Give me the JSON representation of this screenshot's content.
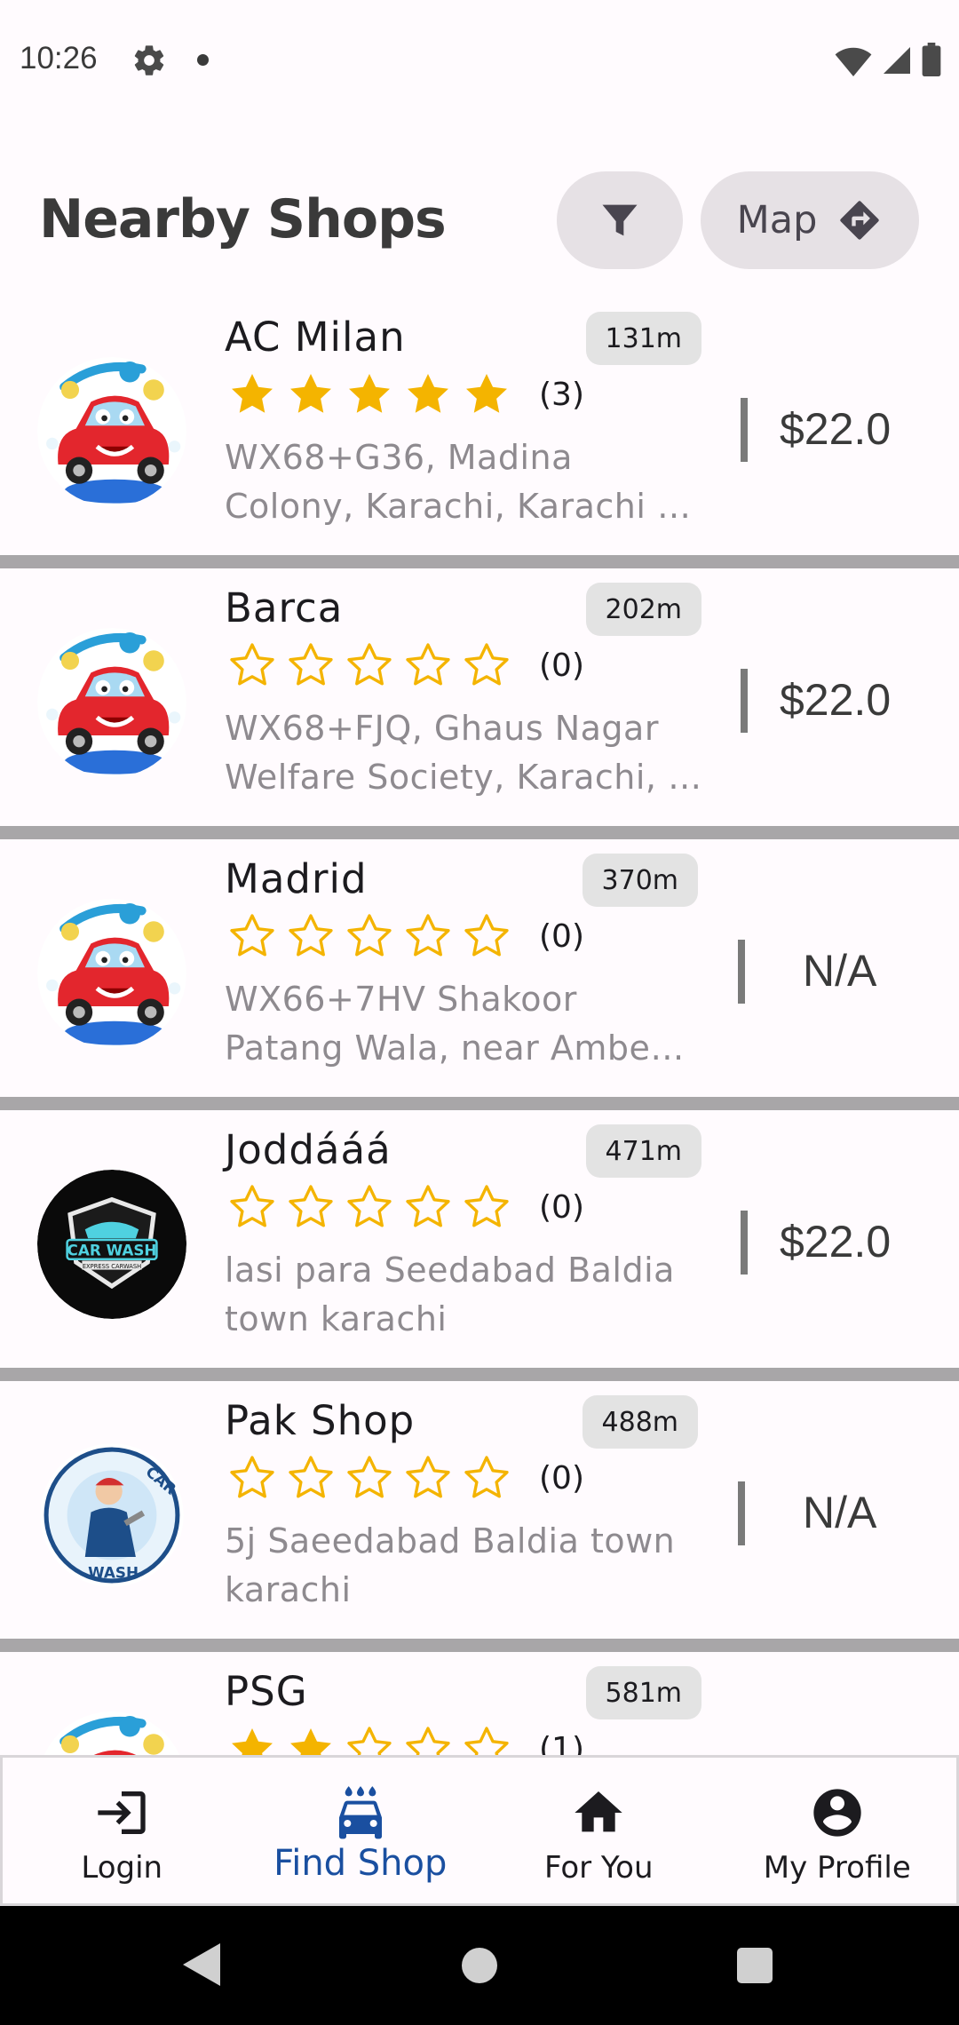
{
  "status": {
    "time": "10:26"
  },
  "header": {
    "title": "Nearby Shops",
    "map_label": "Map"
  },
  "shops": [
    {
      "name": "AC Milan",
      "distance": "131m",
      "rating": 5,
      "reviews": "(3)",
      "address": "WX68+G36, Madina Colony, Karachi, Karachi …",
      "price": "$22.0",
      "logo": "car-wash-cartoon"
    },
    {
      "name": "Barca",
      "distance": "202m",
      "rating": 0,
      "reviews": "(0)",
      "address": "WX68+FJQ, Ghaus Nagar Welfare Society, Karachi, …",
      "price": "$22.0",
      "logo": "car-wash-cartoon"
    },
    {
      "name": "Madrid",
      "distance": "370m",
      "rating": 0,
      "reviews": "(0)",
      "address": "WX66+7HV Shakoor Patang Wala, near Ambe…",
      "price": "N/A",
      "logo": "car-wash-cartoon"
    },
    {
      "name": "Joddááá",
      "distance": "471m",
      "rating": 0,
      "reviews": "(0)",
      "address": "lasi para Seedabad Baldia town karachi",
      "price": "$22.0",
      "logo": "car-wash-badge"
    },
    {
      "name": "Pak Shop",
      "distance": "488m",
      "rating": 0,
      "reviews": "(0)",
      "address": "5j Saeedabad Baldia town karachi",
      "price": "N/A",
      "logo": "car-wash-worker"
    },
    {
      "name": "PSG",
      "distance": "581m",
      "rating": 2,
      "reviews": "(1)",
      "address": "",
      "price": "",
      "logo": "car-wash-cartoon"
    }
  ],
  "badge_logo_text": {
    "main": "CAR WASH",
    "sub": "EXPRESS CARWASH"
  },
  "worker_logo_text": {
    "top": "CAR",
    "bottom": "WASH"
  },
  "bottom_nav": [
    {
      "label": "Login",
      "icon": "login-icon",
      "active": false
    },
    {
      "label": "Find Shop",
      "icon": "car-wash-icon",
      "active": true
    },
    {
      "label": "For You",
      "icon": "home-icon",
      "active": false
    },
    {
      "label": "My Profile",
      "icon": "account-circle-icon",
      "active": false
    }
  ],
  "colors": {
    "star": "#f4b400",
    "active_nav": "#1a4fa0",
    "chip": "#e3e3e3"
  }
}
